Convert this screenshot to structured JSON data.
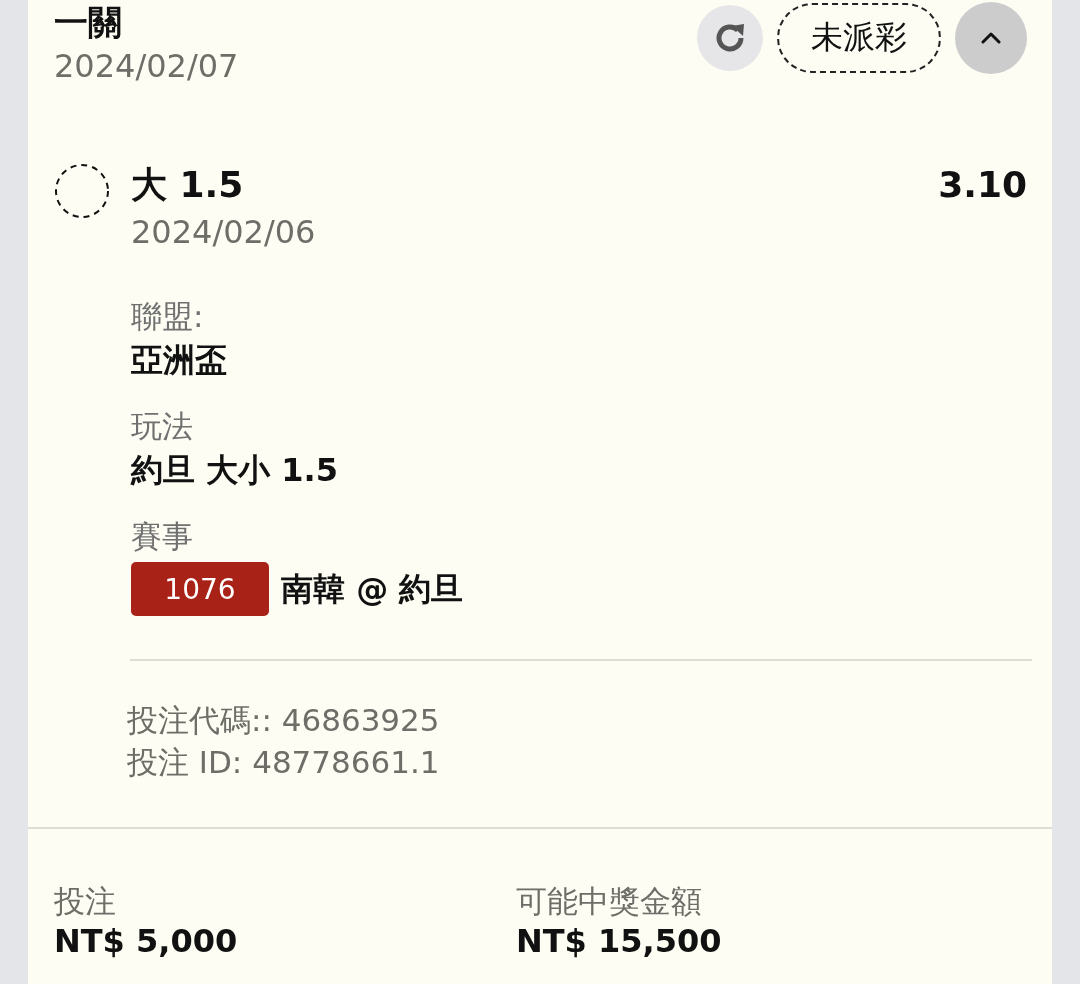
{
  "header": {
    "title": "一關",
    "date": "2024/02/07",
    "status": "未派彩",
    "expanded": true
  },
  "selection": {
    "name": "大 1.5",
    "date": "2024/02/06",
    "odds": "3.10"
  },
  "details": [
    {
      "label": "聯盟:",
      "value": "亞洲盃"
    },
    {
      "label": "玩法",
      "value": "約旦 大小 1.5"
    },
    {
      "label": "賽事",
      "badge": "1076",
      "value": "南韓 @ 約旦"
    }
  ],
  "bet_codes": [
    "投注代碼:: 46863925",
    "投注 ID: 48778661.1"
  ],
  "summary": [
    {
      "label": "投注",
      "value": "NT$ 5,000"
    },
    {
      "label": "可能中獎金額",
      "value": "NT$ 15,500"
    }
  ]
}
